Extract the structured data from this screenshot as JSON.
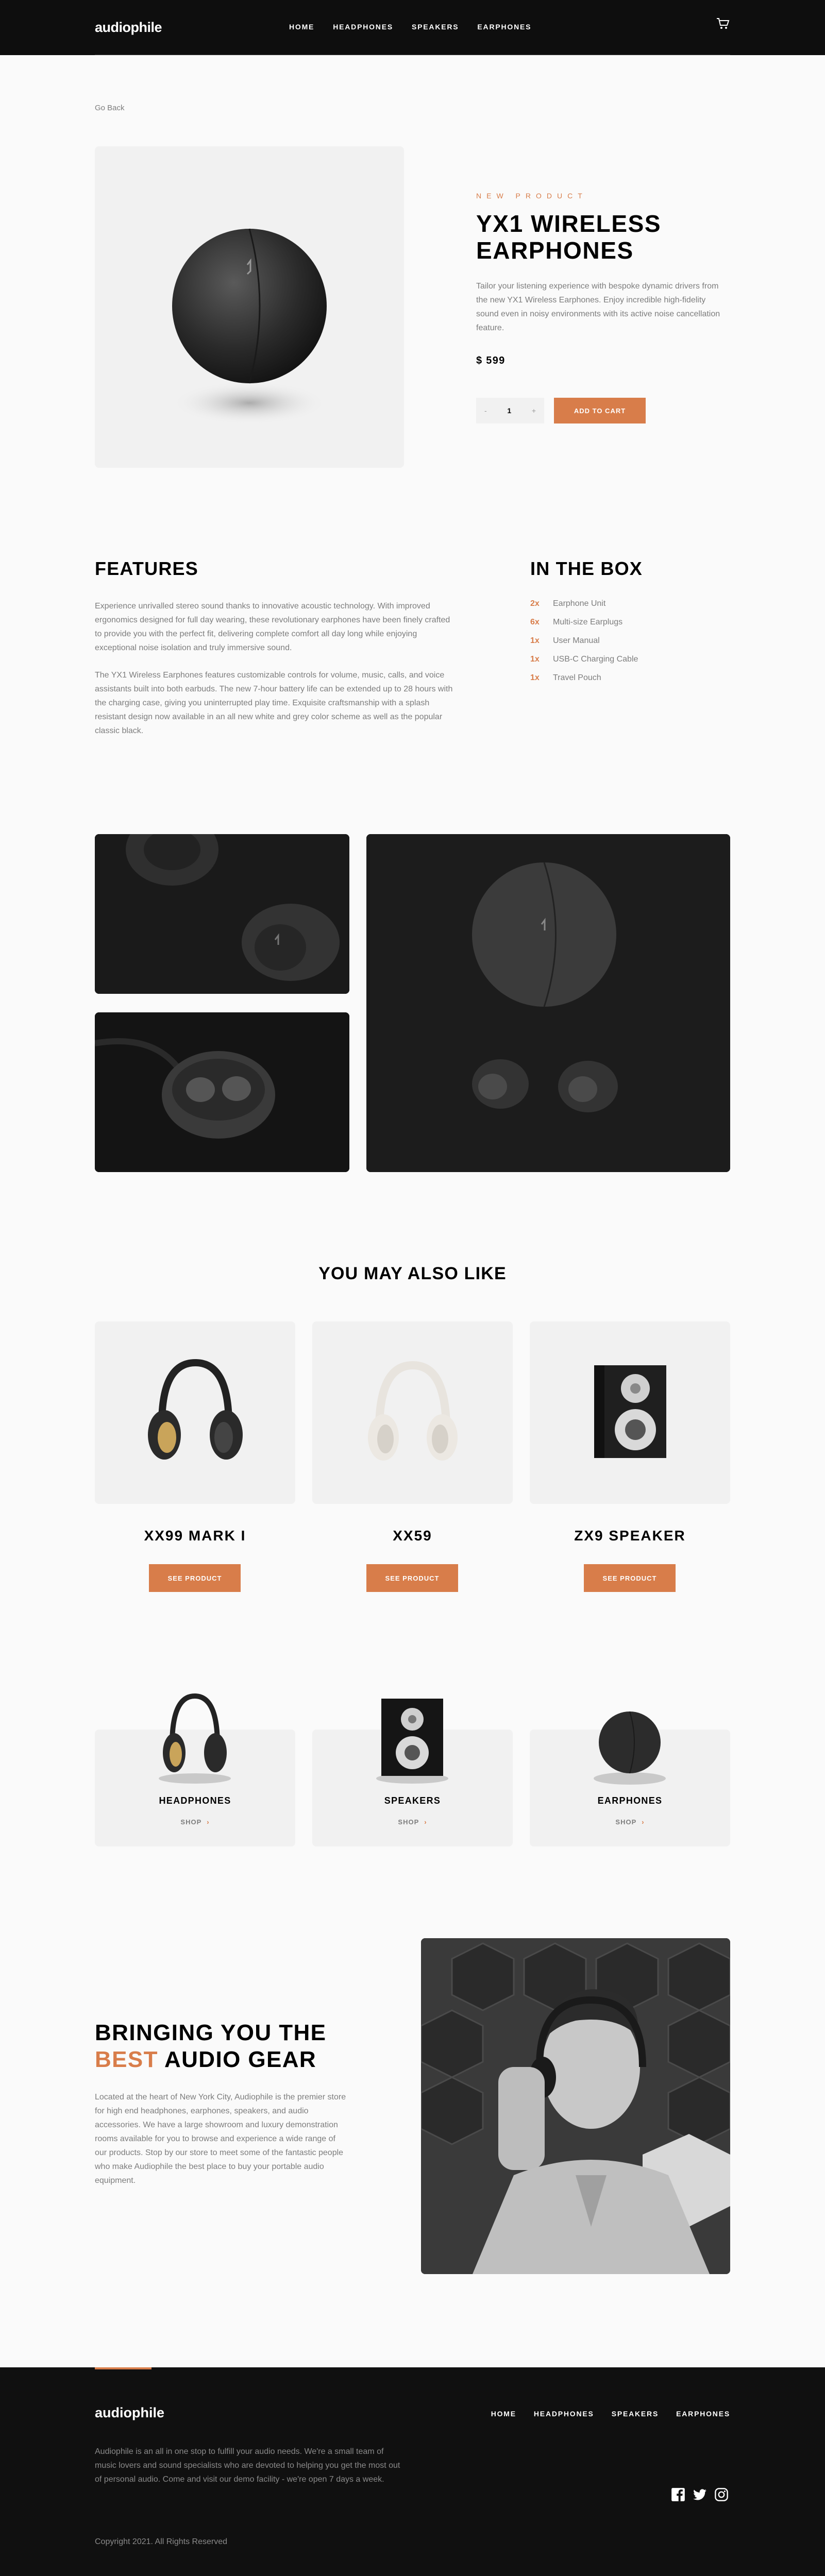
{
  "header": {
    "logo": "audiophile",
    "nav": [
      "HOME",
      "HEADPHONES",
      "SPEAKERS",
      "EARPHONES"
    ],
    "cart_icon": "cart-icon"
  },
  "go_back": "Go Back",
  "product": {
    "eyebrow": "NEW PRODUCT",
    "name": "YX1 WIRELESS EARPHONES",
    "description": "Tailor your listening experience with bespoke dynamic drivers from the new YX1 Wireless Earphones. Enjoy incredible high-fidelity sound even in noisy environments with its active noise cancellation feature.",
    "price": "$ 599",
    "quantity": "1",
    "minus": "-",
    "plus": "+",
    "add_to_cart": "ADD TO CART"
  },
  "features": {
    "heading": "FEATURES",
    "p1": "Experience unrivalled stereo sound thanks to innovative acoustic technology. With improved ergonomics designed for full day wearing, these revolutionary earphones have been finely crafted to provide you with the perfect fit, delivering complete comfort all day long while enjoying exceptional noise isolation and truly immersive sound.",
    "p2": "The YX1 Wireless Earphones features customizable controls for volume, music, calls, and voice assistants built into both earbuds. The new 7-hour battery life can be extended up to 28 hours with the charging case, giving you uninterrupted play time. Exquisite craftsmanship with a splash resistant design now available in an all new white and grey color scheme as well as the popular classic black."
  },
  "in_the_box": {
    "heading": "IN THE BOX",
    "items": [
      {
        "qty": "2x",
        "item": "Earphone Unit"
      },
      {
        "qty": "6x",
        "item": "Multi-size Earplugs"
      },
      {
        "qty": "1x",
        "item": "User Manual"
      },
      {
        "qty": "1x",
        "item": "USB-C Charging Cable"
      },
      {
        "qty": "1x",
        "item": "Travel Pouch"
      }
    ]
  },
  "also_like": {
    "heading": "YOU MAY ALSO LIKE",
    "items": [
      {
        "name": "XX99 MARK I",
        "button": "SEE PRODUCT"
      },
      {
        "name": "XX59",
        "button": "SEE PRODUCT"
      },
      {
        "name": "ZX9 SPEAKER",
        "button": "SEE PRODUCT"
      }
    ]
  },
  "categories": [
    {
      "label": "HEADPHONES",
      "shop": "SHOP"
    },
    {
      "label": "SPEAKERS",
      "shop": "SHOP"
    },
    {
      "label": "EARPHONES",
      "shop": "SHOP"
    }
  ],
  "bringing": {
    "heading_pre": "BRINGING YOU THE",
    "heading_accent": "BEST",
    "heading_post": "AUDIO GEAR",
    "text": "Located at the heart of New York City, Audiophile is the premier store for high end headphones, earphones, speakers, and audio accessories. We have a large showroom and luxury demonstration rooms available for you to browse and experience a wide range of our products. Stop by our store to meet some of the fantastic people who make Audiophile the best place to buy your portable audio equipment."
  },
  "footer": {
    "logo": "audiophile",
    "nav": [
      "HOME",
      "HEADPHONES",
      "SPEAKERS",
      "EARPHONES"
    ],
    "description": "Audiophile is an all in one stop to fulfill your audio needs. We're a small team of music lovers and sound specialists who are devoted to helping you get the most out of personal audio. Come and visit our demo facility - we're open 7 days a week.",
    "copyright": "Copyright 2021. All Rights Reserved",
    "social": [
      "facebook-icon",
      "twitter-icon",
      "instagram-icon"
    ]
  },
  "colors": {
    "accent": "#d87d4a",
    "dark": "#101010",
    "light_gray": "#f1f1f1"
  }
}
